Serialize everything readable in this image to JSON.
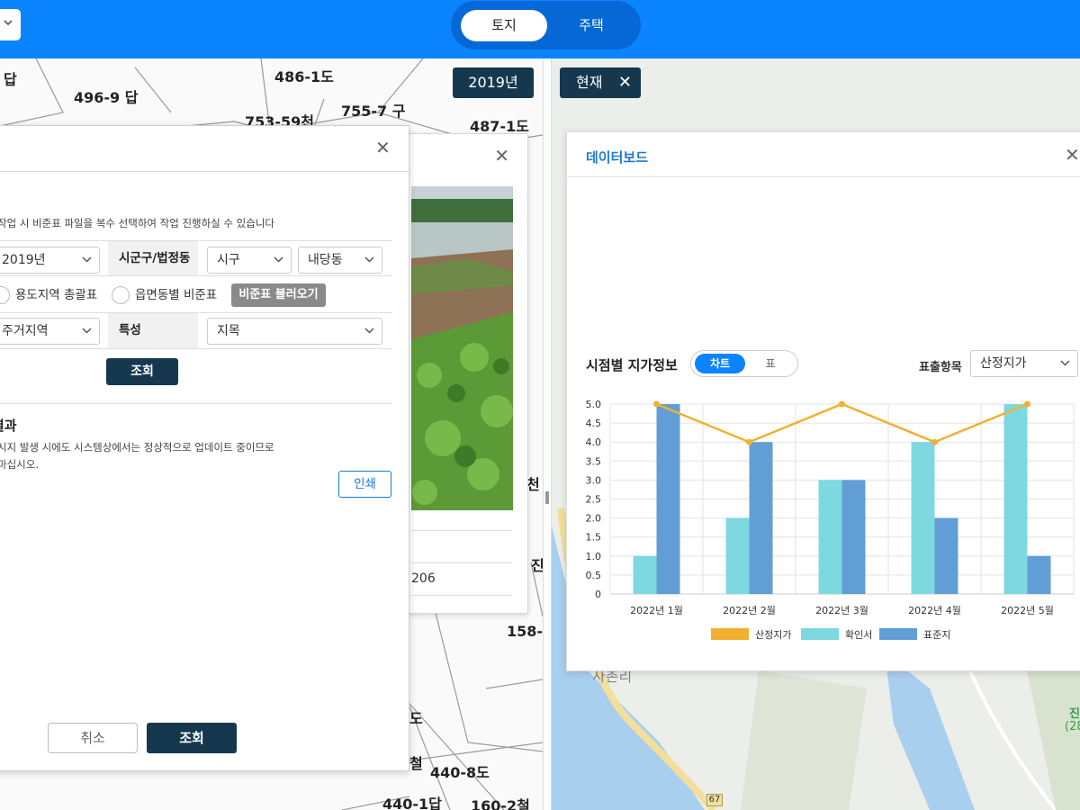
{
  "topbar": {
    "tabs": [
      {
        "label": "토지",
        "active": true
      },
      {
        "label": "주택",
        "active": false
      }
    ],
    "bg": "#0a84ff"
  },
  "map_left": {
    "badge": "2019년",
    "parcels": [
      "486-1도",
      "496-9 답",
      "답",
      "753-59천",
      "755-7 구",
      "487-1도",
      "158-",
      "440-8도",
      "440-1답",
      "160-2철",
      "철",
      "천",
      "도",
      "진"
    ]
  },
  "map_right": {
    "badge": "현재",
    "village": "사촌리",
    "route_shield": "67",
    "place_label": "진",
    "place_sub": "(28"
  },
  "photo_panel": {
    "number_text": "206"
  },
  "main_panel": {
    "notice": "작업 시 비준표 파일을 복수 선택하여 작업 진행하실 수 있습니다",
    "year_select": "2019년",
    "region_label": "시군구/법정동",
    "sigungu_select": "시구",
    "dong_select": "내당동",
    "radio_1": "용도지역 총괄표",
    "radio_2": "읍면동별 비준표",
    "load_button": "비준표 불러오기",
    "zone_select": "주거지역",
    "feature_label": "특성",
    "feature_select": "지목",
    "search_button": "조회",
    "result_title": "결과",
    "result_line_1": "시지 발생 시에도 시스템상에서는 정상적으로 업데이트 중이므로",
    "result_line_2": "마십시오.",
    "print_button": "인쇄",
    "cancel_button": "취소",
    "bottom_search_button": "조회"
  },
  "dashboard": {
    "title": "데이터보드",
    "section_title": "시점별 지가정보",
    "toggle": {
      "chart": "차트",
      "table": "표"
    },
    "export_label": "표출항목",
    "export_select": "산정지가"
  },
  "chart_data": {
    "type": "bar",
    "categories": [
      "2022년 1월",
      "2022년 2월",
      "2022년 3월",
      "2022년 4월",
      "2022년 5월"
    ],
    "series": [
      {
        "name": "산정지가",
        "kind": "line",
        "color": "#f1b12f",
        "values": [
          5,
          4,
          5,
          4,
          5
        ]
      },
      {
        "name": "확인서",
        "kind": "bar",
        "color": "#7dd8e0",
        "values": [
          1,
          2,
          3,
          4,
          5
        ]
      },
      {
        "name": "표준지",
        "kind": "bar",
        "color": "#629ed6",
        "values": [
          5,
          4,
          3,
          2,
          1
        ]
      }
    ],
    "ylim": [
      0,
      5
    ],
    "yticks": [
      "0",
      "0.5",
      "1.0",
      "1.5",
      "2.0",
      "2.5",
      "3.0",
      "3.5",
      "4.0",
      "4.5",
      "5.0"
    ],
    "grid": true,
    "legend_position": "bottom"
  },
  "icons": {
    "close": "close-icon",
    "chevron": "chevron-down-icon"
  }
}
